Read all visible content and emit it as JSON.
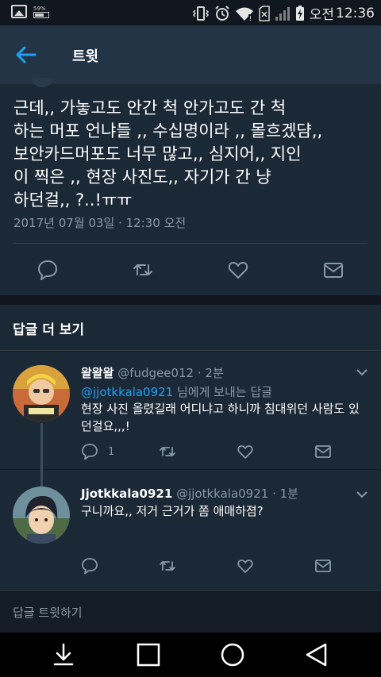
{
  "status_bar": {
    "battery_small_pct": "59%",
    "am_pm": "오전",
    "time": "12:36"
  },
  "header": {
    "title": "트윗"
  },
  "main_tweet": {
    "text": "근데,, 가놓고도 안간 척 안가고도 간 척\n하는 머포 언냐들 ,, 수십명이라 ,, 몰흐겠댬,,\n보안카드머포도 너무 많고,, 심지어,, 지인\n이 찍은 ,, 현장 사진도,, 자기가 간 냥\n하던걸,, ?..!ㅠㅠ",
    "timestamp": "2017년 07월 03일 · 12:30 오전"
  },
  "more_replies": {
    "label": "답글 더 보기"
  },
  "replies": [
    {
      "name": "왈왈왈",
      "handle": "@fudgee012 · 2분",
      "reply_to_handle": "@jjotkkala0921",
      "reply_to_suffix": " 님에게 보내는 답글",
      "text": "현장 사진 올렸길래 어디냐고 하니까 침대위던 사람도 있던걸요,,,!",
      "reply_count": "1"
    },
    {
      "name": "Jjotkkala0921",
      "handle": "@jjotkkala0921 · 1분",
      "text": "구니까요,, 저거 근거가 쫌 애매하졈?"
    }
  ],
  "compose": {
    "placeholder": "답글 트윗하기"
  },
  "colors": {
    "accent": "#1da1f2",
    "background": "#141d26",
    "card": "#1b2836",
    "header": "#243447",
    "muted_text": "#8899a6"
  },
  "icons": [
    "back-arrow-icon",
    "reply-icon",
    "retweet-icon",
    "like-icon",
    "dm-icon",
    "chevron-down-icon",
    "download-nav-icon",
    "recents-icon",
    "home-icon",
    "back-nav-icon"
  ]
}
